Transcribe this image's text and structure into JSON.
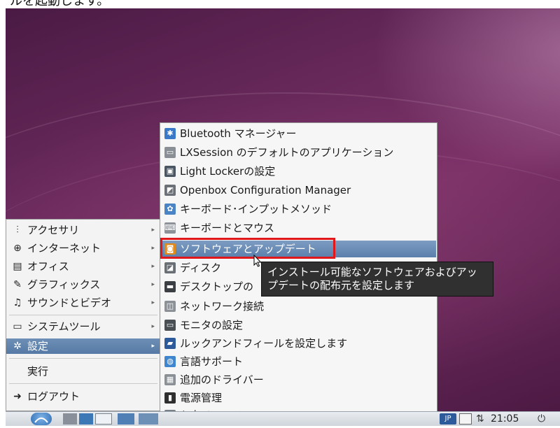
{
  "top_text": "ルを起動します。",
  "main_menu": {
    "items": [
      {
        "label": "アクセサリ",
        "icon": "accessories-icon",
        "glyph": "⫶"
      },
      {
        "label": "インターネット",
        "icon": "globe-icon",
        "glyph": "⊕"
      },
      {
        "label": "オフィス",
        "icon": "office-icon",
        "glyph": "▤"
      },
      {
        "label": "グラフィックス",
        "icon": "graphics-icon",
        "glyph": "✎"
      },
      {
        "label": "サウンドとビデオ",
        "icon": "sound-video-icon",
        "glyph": "♫"
      },
      {
        "label": "システムツール",
        "icon": "system-tools-icon",
        "glyph": "▭"
      },
      {
        "label": "設定",
        "icon": "settings-icon",
        "glyph": "✲"
      },
      {
        "label": "実行",
        "icon": "",
        "glyph": ""
      },
      {
        "label": "ログアウト",
        "icon": "logout-icon",
        "glyph": "➜"
      }
    ],
    "active_label": "設定"
  },
  "sub_menu": {
    "items": [
      {
        "label": "Bluetooth マネージャー",
        "icon": "bluetooth-icon",
        "glyph": "✱",
        "color": "#3a78c8"
      },
      {
        "label": "LXSession のデフォルトのアプリケーション",
        "icon": "lxsession-icon",
        "glyph": "▭",
        "color": "#8a8f96"
      },
      {
        "label": "Light Lockerの設定",
        "icon": "monitor-lock-icon",
        "glyph": "▣",
        "color": "#4b5663"
      },
      {
        "label": "Openbox Configuration Manager",
        "icon": "openbox-icon",
        "glyph": "◩",
        "color": "#6c7178"
      },
      {
        "label": "キーボード･インプットメソッド",
        "icon": "keyboard-gear-icon",
        "glyph": "✿",
        "color": "#4a84c4"
      },
      {
        "label": "キーボードとマウス",
        "icon": "keyboard-mouse-icon",
        "glyph": "⌨",
        "color": "#8d9299"
      },
      {
        "label": "ソフトウェアとアップデート",
        "icon": "software-updates-icon",
        "glyph": "◙",
        "color": "#e08a1c"
      },
      {
        "label": "ディスク",
        "icon": "disk-icon",
        "glyph": "◪",
        "color": "#6a6f76"
      },
      {
        "label": "デスクトップの",
        "icon": "desktop-icon",
        "glyph": "▬",
        "color": "#3b3f44"
      },
      {
        "label": "ネットワーク接続",
        "icon": "network-icon",
        "glyph": "◫",
        "color": "#8c9198"
      },
      {
        "label": "モニタの設定",
        "icon": "monitor-icon",
        "glyph": "▭",
        "color": "#4a4f55"
      },
      {
        "label": "ルックアンドフィールを設定します",
        "icon": "appearance-icon",
        "glyph": "▰",
        "color": "#2d5a9a"
      },
      {
        "label": "言語サポート",
        "icon": "language-icon",
        "glyph": "◍",
        "color": "#3f86cf"
      },
      {
        "label": "追加のドライバー",
        "icon": "drivers-icon",
        "glyph": "▦",
        "color": "#8b9097"
      },
      {
        "label": "電源管理",
        "icon": "power-manager-icon",
        "glyph": "▮",
        "color": "#2f2f2f"
      },
      {
        "label": "入力メソッド",
        "icon": "input-method-icon",
        "glyph": "⌨",
        "color": "#7a8088"
      }
    ],
    "active_label": "ソフトウェアとアップデート"
  },
  "tooltip": {
    "line1": "インストール可能なソフトウェアおよびアッ",
    "line2": "プデートの配布元を設定します"
  },
  "taskbar": {
    "keyboard_layout": "JP",
    "clock": "21:05"
  }
}
